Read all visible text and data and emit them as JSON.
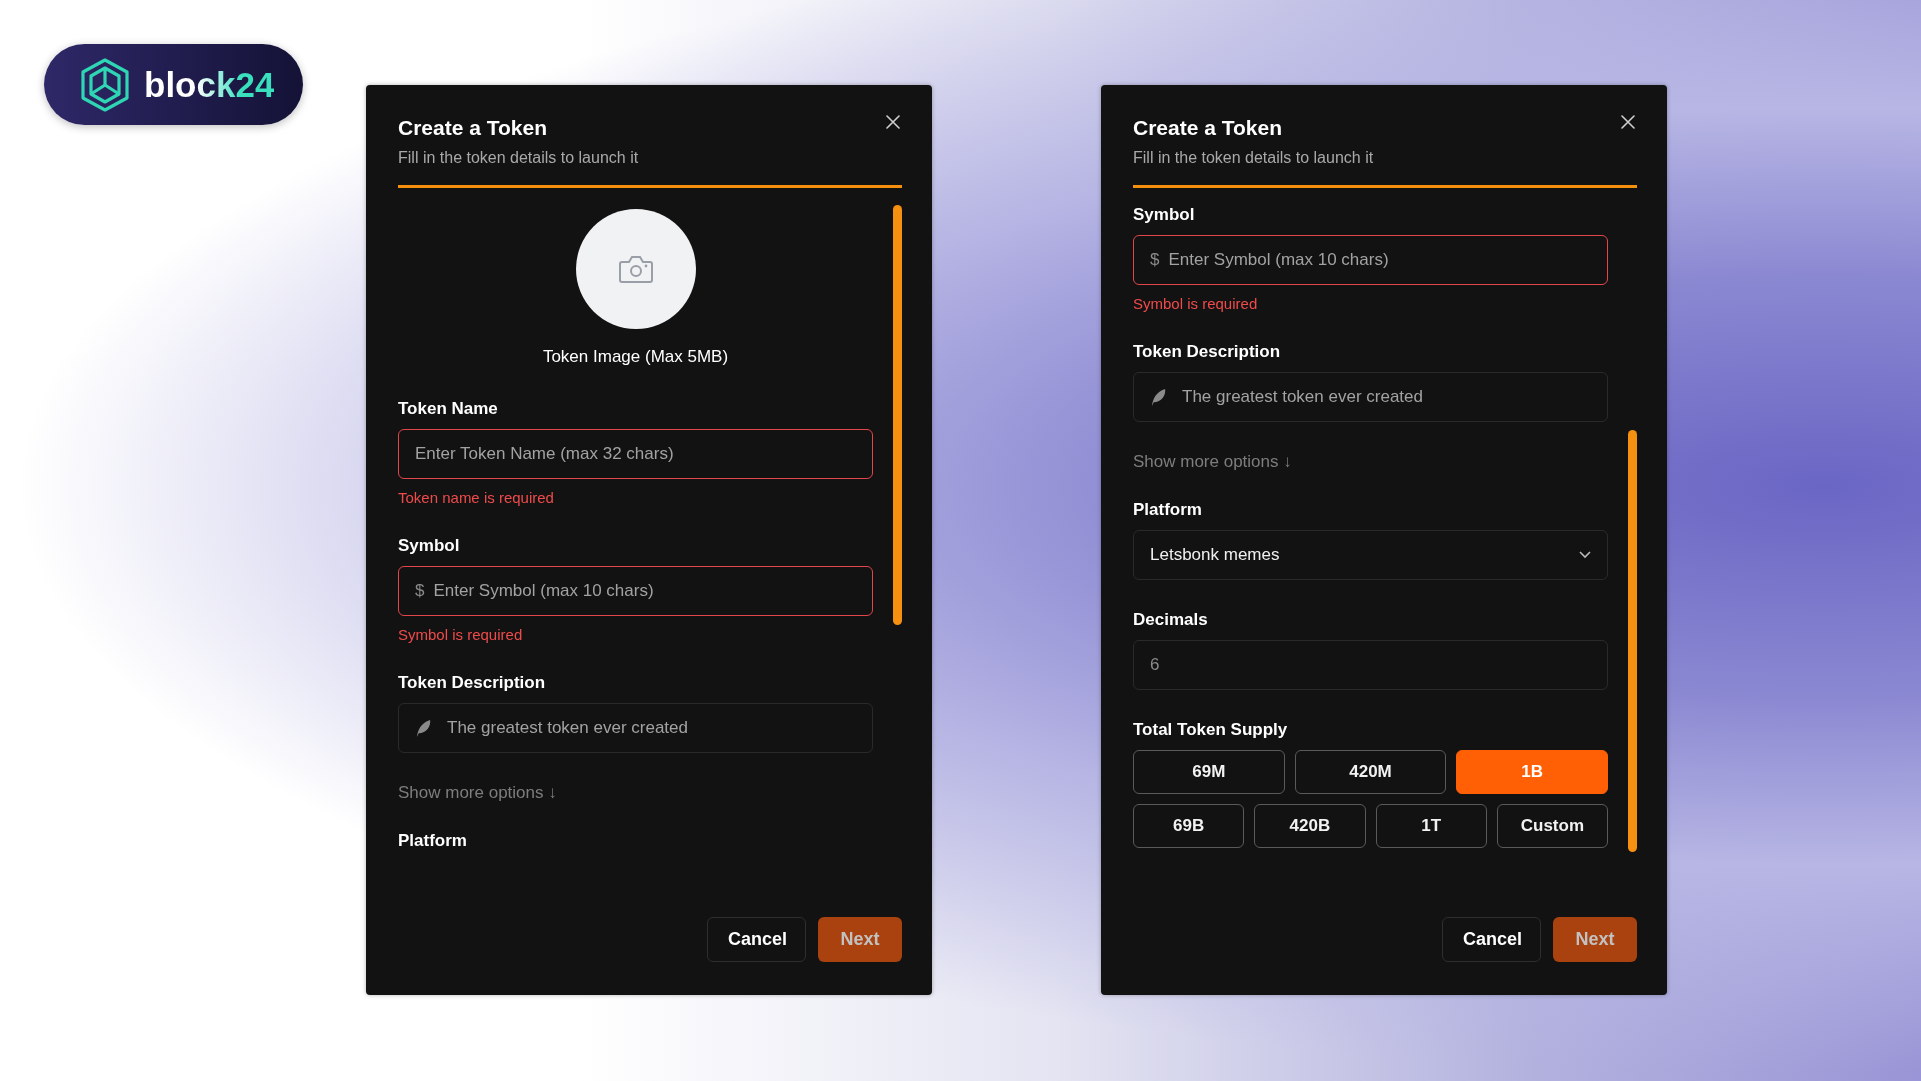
{
  "logo": {
    "text": "block24"
  },
  "dialogs": [
    {
      "title": "Create a Token",
      "subtitle": "Fill in the token details to launch it",
      "fields": [
        {
          "kind": "image",
          "label": "Token Image (Max 5MB)"
        },
        {
          "kind": "input",
          "label": "Token Name",
          "placeholder": "Enter Token Name (max 32 chars)",
          "error": "Token name is required"
        },
        {
          "kind": "input",
          "label": "Symbol",
          "prefix": "$",
          "placeholder": "Enter Symbol (max 10 chars)",
          "error": "Symbol is required"
        },
        {
          "kind": "description",
          "label": "Token Description",
          "placeholder": "The greatest token ever created"
        },
        {
          "kind": "link",
          "text": "Show more options ↓"
        },
        {
          "kind": "heading",
          "label": "Platform"
        }
      ],
      "buttons": [
        {
          "label": "Cancel",
          "kind": "secondary"
        },
        {
          "label": "Next",
          "kind": "primary"
        }
      ]
    },
    {
      "title": "Create a Token",
      "subtitle": "Fill in the token details to launch it",
      "fields": [
        {
          "kind": "input",
          "label": "Symbol",
          "prefix": "$",
          "placeholder": "Enter Symbol (max 10 chars)",
          "error": "Symbol is required"
        },
        {
          "kind": "description",
          "label": "Token Description",
          "placeholder": "The greatest token ever created"
        },
        {
          "kind": "link",
          "text": "Show more options ↓"
        },
        {
          "kind": "select",
          "label": "Platform",
          "value": "Letsbonk memes"
        },
        {
          "kind": "value",
          "label": "Decimals",
          "value": "6"
        },
        {
          "kind": "options",
          "label": "Total Token Supply",
          "options": [
            {
              "label": "69M",
              "selected": false
            },
            {
              "label": "420M",
              "selected": false
            },
            {
              "label": "1B",
              "selected": true
            },
            {
              "label": "69B",
              "selected": false
            },
            {
              "label": "420B",
              "selected": false
            },
            {
              "label": "1T",
              "selected": false
            },
            {
              "label": "Custom",
              "selected": false
            }
          ]
        }
      ],
      "buttons": [
        {
          "label": "Cancel",
          "kind": "secondary"
        },
        {
          "label": "Next",
          "kind": "primary"
        }
      ]
    }
  ]
}
